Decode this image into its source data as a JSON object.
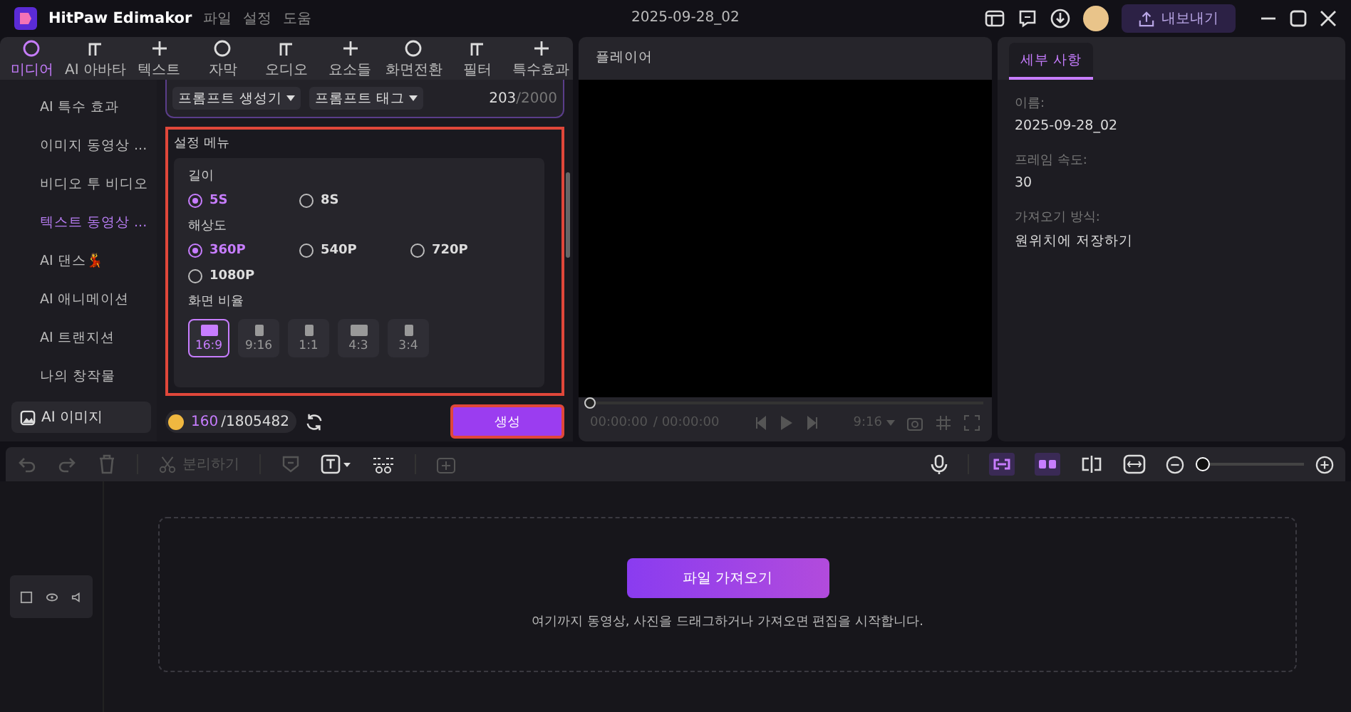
{
  "window": {
    "app_name": "HitPaw Edimakor",
    "menu": [
      "파일",
      "설정",
      "도움"
    ],
    "project_title": "2025-09-28_02",
    "export_button": "내보내기"
  },
  "tabs": [
    {
      "label": "미디어",
      "selected": true
    },
    {
      "label": "AI 아바타",
      "selected": false
    },
    {
      "label": "텍스트",
      "selected": false
    },
    {
      "label": "자막",
      "selected": false
    },
    {
      "label": "오디오",
      "selected": false
    },
    {
      "label": "요소들",
      "selected": false
    },
    {
      "label": "화면전환",
      "selected": false
    },
    {
      "label": "필터",
      "selected": false
    },
    {
      "label": "특수효과",
      "selected": false
    }
  ],
  "sidebar": {
    "items": [
      {
        "label": "AI 특수 효과",
        "selected": false
      },
      {
        "label": "이미지 동영상 ...",
        "selected": false
      },
      {
        "label": "비디오 투 비디오",
        "selected": false
      },
      {
        "label": "텍스트 동영상 ...",
        "selected": true
      },
      {
        "label": "AI 댄스",
        "selected": false,
        "emoji": "💃"
      },
      {
        "label": "AI 애니메이션",
        "selected": false
      },
      {
        "label": "AI 트랜지션",
        "selected": false
      },
      {
        "label": "나의 창작물",
        "selected": false
      }
    ],
    "category": "AI 이미지"
  },
  "prompt": {
    "buttons": [
      "프롬프트 생성기",
      "프롬프트 태그"
    ],
    "count": "203",
    "limit": "/2000"
  },
  "settings": {
    "title": "설정 메뉴",
    "highlighted": true,
    "groups": [
      {
        "label": "길이",
        "kind": "radio",
        "options": [
          {
            "label": "5S",
            "selected": true
          },
          {
            "label": "8S",
            "selected": false
          }
        ]
      },
      {
        "label": "해상도",
        "kind": "radio",
        "options": [
          {
            "label": "360P",
            "selected": true
          },
          {
            "label": "540P",
            "selected": false
          },
          {
            "label": "720P",
            "selected": false
          },
          {
            "label": "1080P",
            "selected": false
          }
        ]
      },
      {
        "label": "화면 비율",
        "kind": "ratio",
        "options": [
          {
            "label": "16:9",
            "selected": true
          },
          {
            "label": "9:16",
            "selected": false
          },
          {
            "label": "1:1",
            "selected": false
          },
          {
            "label": "4:3",
            "selected": false
          },
          {
            "label": "3:4",
            "selected": false
          }
        ]
      }
    ]
  },
  "credits": {
    "used": "160",
    "total": "/1805482"
  },
  "generate_button": {
    "label": "생성",
    "highlighted": true
  },
  "player": {
    "title": "플레이어",
    "level": 0,
    "time": "00:00:00",
    "duration": "/ 00:00:00",
    "ratio": "9:16"
  },
  "details": {
    "tab": {
      "label": "세부 사항",
      "selected": true
    },
    "fields": [
      {
        "label": "이름:",
        "value": "2025-09-28_02"
      },
      {
        "label": "프레임 속도:",
        "value": "30"
      },
      {
        "label": "가져오기 방식:",
        "value": "원위치에 저장하기"
      }
    ]
  },
  "toolbar": {
    "split": {
      "label": "분리하기",
      "disabled": true
    },
    "zoom": {
      "level": 0
    }
  },
  "timeline": {
    "import_button": "파일 가져오기",
    "hint": "여기까지 동영상, 사진을 드래그하거나 가져오면 편집을 시작합니다."
  }
}
